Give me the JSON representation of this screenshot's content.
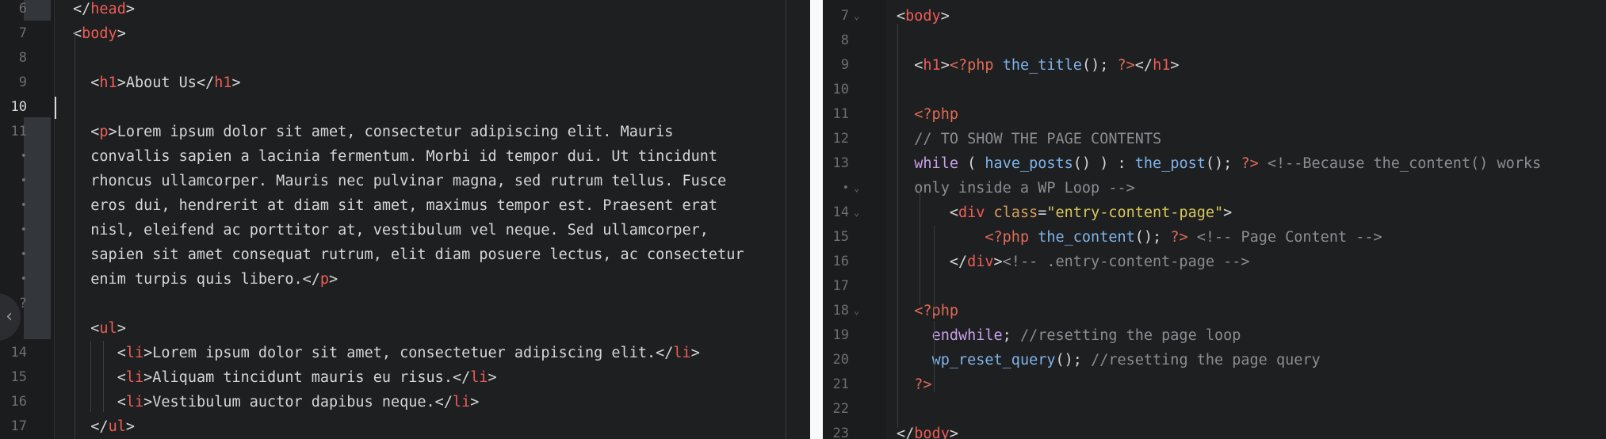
{
  "left_editor": {
    "lines": [
      {
        "num": "6",
        "html": "<span class=\"pl\">&lt;/</span><span class=\"t\">head</span><span class=\"pl\">&gt;</span>"
      },
      {
        "num": "7",
        "html": "<span class=\"pl\">&lt;</span><span class=\"t\">body</span><span class=\"pl\">&gt;</span>"
      },
      {
        "num": "8",
        "html": ""
      },
      {
        "num": "9",
        "html": "  <span class=\"pl\">&lt;</span><span class=\"t\">h1</span><span class=\"pl\">&gt;About Us&lt;/</span><span class=\"t\">h1</span><span class=\"pl\">&gt;</span>"
      },
      {
        "num": "10",
        "html": ""
      },
      {
        "num": "11",
        "html": "  <span class=\"pl\">&lt;</span><span class=\"t\">p</span><span class=\"pl\">&gt;Lorem ipsum dolor sit amet, consectetur adipiscing elit. Mauris</span>"
      },
      {
        "num": "•",
        "html": "  <span class=\"pl\">convallis sapien a lacinia fermentum. Morbi id tempor dui. Ut tincidunt</span>"
      },
      {
        "num": "•",
        "html": "  <span class=\"pl\">rhoncus ullamcorper. Mauris nec pulvinar magna, sed rutrum tellus. Fusce</span>"
      },
      {
        "num": "•",
        "html": "  <span class=\"pl\">eros dui, hendrerit at diam sit amet, maximus tempor est. Praesent erat</span>"
      },
      {
        "num": "•",
        "html": "  <span class=\"pl\">nisl, eleifend ac porttitor at, vestibulum vel neque. Sed ullamcorper,</span>"
      },
      {
        "num": "•",
        "html": "  <span class=\"pl\">sapien sit amet consequat rutrum, elit diam posuere lectus, ac consectetur</span>"
      },
      {
        "num": "•",
        "html": "  <span class=\"pl\">enim turpis quis libero.&lt;/</span><span class=\"t\">p</span><span class=\"pl\">&gt;</span>"
      },
      {
        "num": "?",
        "html": ""
      },
      {
        "num": "",
        "html": "  <span class=\"pl\">&lt;</span><span class=\"t\">ul</span><span class=\"pl\">&gt;</span>"
      },
      {
        "num": "14",
        "html": "     <span class=\"pl\">&lt;</span><span class=\"t\">li</span><span class=\"pl\">&gt;Lorem ipsum dolor sit amet, consectetuer adipiscing elit.&lt;/</span><span class=\"t\">li</span><span class=\"pl\">&gt;</span>"
      },
      {
        "num": "15",
        "html": "     <span class=\"pl\">&lt;</span><span class=\"t\">li</span><span class=\"pl\">&gt;Aliquam tincidunt mauris eu risus.&lt;/</span><span class=\"t\">li</span><span class=\"pl\">&gt;</span>"
      },
      {
        "num": "16",
        "html": "     <span class=\"pl\">&lt;</span><span class=\"t\">li</span><span class=\"pl\">&gt;Vestibulum auctor dapibus neque.&lt;/</span><span class=\"t\">li</span><span class=\"pl\">&gt;</span>"
      },
      {
        "num": "17",
        "html": "  <span class=\"pl\">&lt;/</span><span class=\"t\">ul</span><span class=\"pl\">&gt;</span>"
      }
    ]
  },
  "right_editor": {
    "lines": [
      {
        "num": "7",
        "fold": true,
        "html": "<span class=\"pl\">&lt;</span><span class=\"t\">body</span><span class=\"pl\">&gt;</span>"
      },
      {
        "num": "8",
        "fold": false,
        "html": ""
      },
      {
        "num": "9",
        "fold": false,
        "html": "  <span class=\"pl\">&lt;</span><span class=\"t\">h1</span><span class=\"pl\">&gt;</span><span class=\"pt\">&lt;?php</span> <span class=\"fn\">the_title</span><span class=\"pl\">();</span> <span class=\"pt\">?&gt;</span><span class=\"pl\">&lt;/</span><span class=\"t\">h1</span><span class=\"pl\">&gt;</span>"
      },
      {
        "num": "10",
        "fold": false,
        "html": ""
      },
      {
        "num": "11",
        "fold": false,
        "html": "  <span class=\"pt\">&lt;?php</span>"
      },
      {
        "num": "12",
        "fold": false,
        "html": "  <span class=\"cm\">// TO SHOW THE PAGE CONTENTS</span>"
      },
      {
        "num": "13",
        "fold": false,
        "html": "  <span class=\"kw\">while</span> <span class=\"pl\">(</span> <span class=\"fn\">have_posts</span><span class=\"pl\">() ) :</span> <span class=\"fn\">the_post</span><span class=\"pl\">();</span> <span class=\"pt\">?&gt;</span> <span class=\"cm\">&lt;!--Because the_content() works</span>"
      },
      {
        "num": "•",
        "fold": true,
        "html": "  <span class=\"cm\">only inside a WP Loop --&gt;</span>"
      },
      {
        "num": "14",
        "fold": true,
        "html": "      <span class=\"pl\">&lt;</span><span class=\"t\">div</span> <span class=\"at\">class</span><span class=\"pl\">=</span><span class=\"str\">\"entry-content-page\"</span><span class=\"pl\">&gt;</span>"
      },
      {
        "num": "15",
        "fold": false,
        "html": "          <span class=\"pt\">&lt;?php</span> <span class=\"fn\">the_content</span><span class=\"pl\">();</span> <span class=\"pt\">?&gt;</span> <span class=\"cm\">&lt;!-- Page Content --&gt;</span>"
      },
      {
        "num": "16",
        "fold": false,
        "html": "      <span class=\"pl\">&lt;/</span><span class=\"t\">div</span><span class=\"pl\">&gt;</span><span class=\"cm\">&lt;!-- .entry-content-page --&gt;</span>"
      },
      {
        "num": "17",
        "fold": false,
        "html": ""
      },
      {
        "num": "18",
        "fold": true,
        "html": "  <span class=\"pt\">&lt;?php</span>"
      },
      {
        "num": "19",
        "fold": false,
        "html": "    <span class=\"kw\">endwhile</span><span class=\"pl\">;</span> <span class=\"cm\">//resetting the page loop</span>"
      },
      {
        "num": "20",
        "fold": false,
        "html": "    <span class=\"fn\">wp_reset_query</span><span class=\"pl\">();</span> <span class=\"cm\">//resetting the page query</span>"
      },
      {
        "num": "21",
        "fold": false,
        "html": "  <span class=\"pt\">?&gt;</span>"
      },
      {
        "num": "22",
        "fold": false,
        "html": ""
      },
      {
        "num": "23",
        "fold": false,
        "html": "<span class=\"pl\">&lt;/</span><span class=\"t\">body</span><span class=\"pl\">&gt;</span>"
      }
    ]
  },
  "nav_arrow": "‹"
}
